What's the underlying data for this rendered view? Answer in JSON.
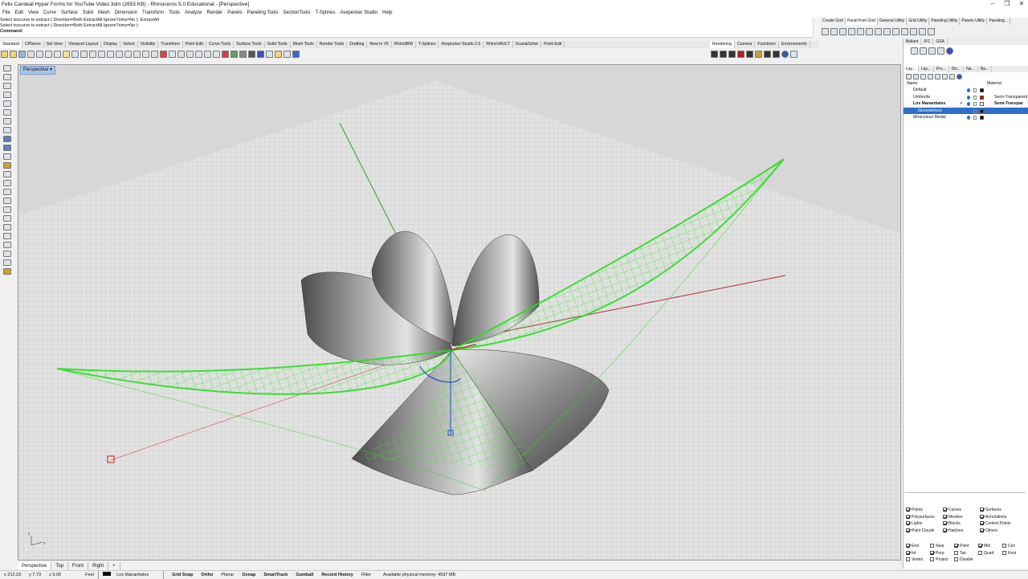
{
  "window": {
    "title": "Felix Candeal Hypar Forms for YouTube Video.3dm (2653 KB) - Rhinoceros 5.0 Educational - [Perspective]",
    "controls": [
      "–",
      "❐",
      "✕"
    ]
  },
  "menu": [
    "File",
    "Edit",
    "View",
    "Curve",
    "Surface",
    "Solid",
    "Mesh",
    "Dimension",
    "Transform",
    "Tools",
    "Analyze",
    "Render",
    "Panels",
    "Paneling Tools",
    "SectionTools",
    "T-Splines",
    "Avxpecker Studio",
    "Help"
  ],
  "command": {
    "history": [
      "Select isocurve to extract ( Direction=Both  ExtractAll  IgnoreTrims=No ): ExtractAll",
      "Select isocurve to extract ( Direction=Both  ExtractAll  IgnoreTrims=No ):"
    ],
    "prompt": "Command:"
  },
  "right_top_tabs": [
    "Create Grid",
    "Panel from Grid",
    "General Utility",
    "Grid Utility",
    "Paneling Utility",
    "Panels Utility",
    "Paneling..."
  ],
  "toolbar_tabs": [
    "Standard",
    "CPlanes",
    "Set View",
    "Viewport Layout",
    "Display",
    "Select",
    "Visibility",
    "Transform",
    "Point Edit",
    "Curve Tools",
    "Surface Tools",
    "Solid Tools",
    "Mesh Tools",
    "Render Tools",
    "Drafting",
    "New in V5",
    "RhinoBIM",
    "T-Splines",
    "Avxpecker Studio 2.5",
    "RhinoVAULT",
    "Scan&Solve",
    "Point Edit"
  ],
  "render_tabs": [
    "Rendering",
    "Camera",
    "Functions",
    "Environments"
  ],
  "viewport": {
    "label": "Perspective",
    "dropdown_icon": "chevron-down-icon"
  },
  "panel": {
    "top_tabs": [
      "Bullant",
      "IFC",
      "GSA"
    ],
    "tabs": [
      "Lay...",
      "Lay...",
      "Pro...",
      "Dis...",
      "Na...",
      "Na..."
    ],
    "columns": {
      "name": "Name",
      "material": "Material"
    },
    "layers": [
      {
        "name": "Default",
        "color": "#000000",
        "material": "",
        "current": false,
        "selected": false
      },
      {
        "name": "Umbrella",
        "color": "#cc0000",
        "material": "Semi-Transparent",
        "current": false,
        "selected": false
      },
      {
        "name": "Los Manantiales",
        "color": "#ffffff",
        "material": "Semi-Transpar",
        "current": true,
        "selected": false
      },
      {
        "name": "Generatrices",
        "color": "#000000",
        "material": "",
        "current": false,
        "selected": true
      },
      {
        "name": "Miraculous Medal",
        "color": "#000000",
        "material": "",
        "current": false,
        "selected": false
      }
    ],
    "current_mark": "✓",
    "filters": [
      [
        {
          "label": "Points",
          "on": true
        },
        {
          "label": "Curves",
          "on": true
        },
        {
          "label": "Surfaces",
          "on": true
        }
      ],
      [
        {
          "label": "Polysurfaces",
          "on": true
        },
        {
          "label": "Meshes",
          "on": true
        },
        {
          "label": "Annotations",
          "on": true
        }
      ],
      [
        {
          "label": "Lights",
          "on": true
        },
        {
          "label": "Blocks",
          "on": true
        },
        {
          "label": "Control Points",
          "on": true
        }
      ],
      [
        {
          "label": "Point Clouds",
          "on": true
        },
        {
          "label": "Hatches",
          "on": true
        },
        {
          "label": "Others",
          "on": true
        }
      ]
    ],
    "osnaps": [
      [
        {
          "label": "End",
          "on": true
        },
        {
          "label": "Near",
          "on": false
        },
        {
          "label": "Point",
          "on": true
        },
        {
          "label": "Mid",
          "on": true
        },
        {
          "label": "Cen",
          "on": false
        }
      ],
      [
        {
          "label": "Int",
          "on": true
        },
        {
          "label": "Perp",
          "on": true
        },
        {
          "label": "Tan",
          "on": false
        },
        {
          "label": "Quad",
          "on": false
        },
        {
          "label": "Knot",
          "on": false
        }
      ],
      [
        {
          "label": "Vertex",
          "on": false
        },
        {
          "label": "Project",
          "on": false
        },
        {
          "label": "Disable",
          "on": false
        }
      ]
    ]
  },
  "bottom_tabs": [
    "Perspective",
    "Top",
    "Front",
    "Right",
    "+"
  ],
  "status": {
    "x": "x 212.23",
    "y": "y 7.73",
    "z": "z 0.00",
    "units": "Feet",
    "layer": "Los Manantiales",
    "toggles": [
      "Grid Snap",
      "Ortho",
      "Planar",
      "Osnap",
      "SmartTrack",
      "Gumball",
      "Record History",
      "Filter"
    ],
    "memory": "Available physical memory: 4597 MB"
  },
  "colors": {
    "accent": "#2f6ec9",
    "grid_bg": "#d7d7d7",
    "mesh": "#33ee22",
    "x_axis": "#b03030",
    "y_axis": "#2aa02a"
  }
}
